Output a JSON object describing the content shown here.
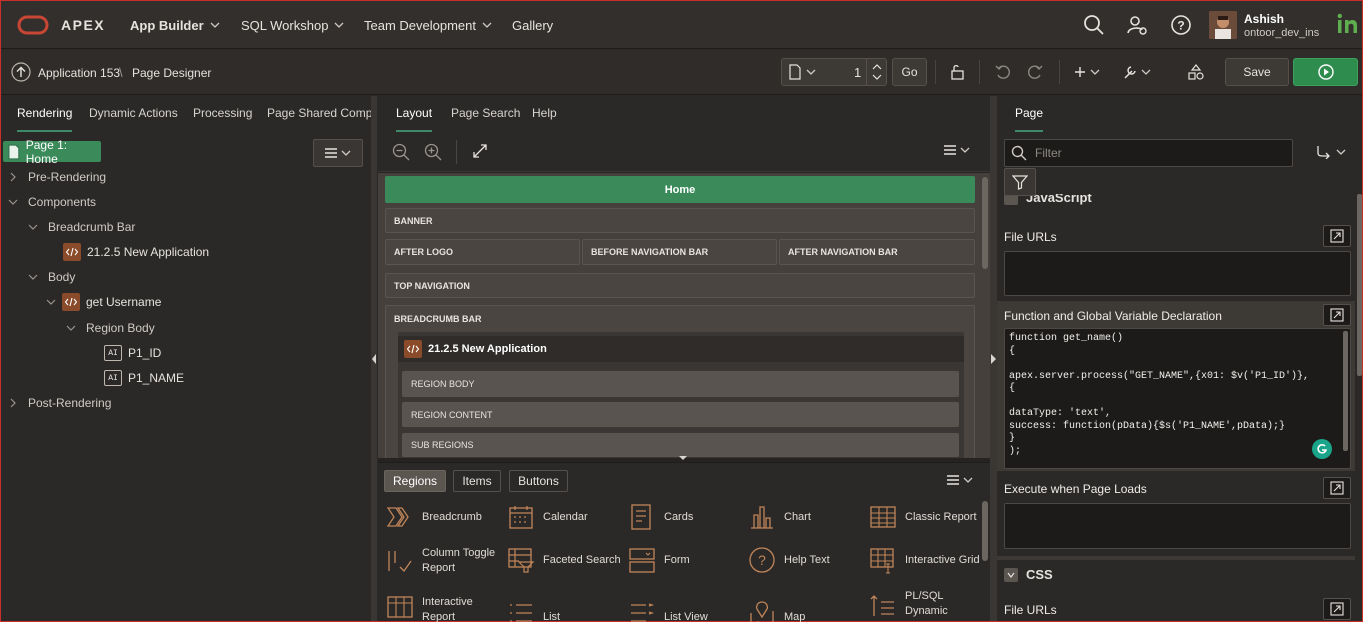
{
  "topbar": {
    "brand": "APEX",
    "nav": [
      "App Builder",
      "SQL Workshop",
      "Team Development",
      "Gallery"
    ],
    "user_name": "Ashish",
    "user_workspace": "ontoor_dev_ins",
    "colors": {
      "bg": "#332f2c",
      "brand_red": "#c74634"
    }
  },
  "toolbar": {
    "breadcrumb_app": "Application 153",
    "breadcrumb_sep": "\\",
    "breadcrumb_page": "Page Designer",
    "page_number": "1",
    "go_label": "Go",
    "save_label": "Save",
    "colors": {
      "run_button": "#2f8c4f"
    }
  },
  "left": {
    "tabs": [
      "Rendering",
      "Dynamic Actions",
      "Processing",
      "Page Shared Compor"
    ],
    "page_node": "Page 1: Home",
    "tree": {
      "pre_rendering": "Pre-Rendering",
      "components": "Components",
      "breadcrumb_bar": "Breadcrumb Bar",
      "breadcrumb_region": "21.2.5 New Application",
      "body": "Body",
      "get_username": "get Username",
      "region_body": "Region Body",
      "item1": "P1_ID",
      "item2": "P1_NAME",
      "post_rendering": "Post-Rendering",
      "item_icon": "AI"
    }
  },
  "center": {
    "tabs": [
      "Layout",
      "Page Search",
      "Help"
    ],
    "layout": {
      "page_title": "Home",
      "banner": "BANNER",
      "after_logo": "AFTER LOGO",
      "before_nav": "BEFORE NAVIGATION BAR",
      "after_nav": "AFTER NAVIGATION BAR",
      "top_nav": "TOP NAVIGATION",
      "breadcrumb_bar": "BREADCRUMB BAR",
      "region_title": "21.2.5 New Application",
      "region_body": "REGION BODY",
      "region_content": "REGION CONTENT",
      "sub_regions": "SUB REGIONS"
    },
    "gallery_tabs": [
      "Regions",
      "Items",
      "Buttons"
    ],
    "gallery": [
      "Breadcrumb",
      "Calendar",
      "Cards",
      "Chart",
      "Classic Report",
      "Column Toggle Report",
      "Faceted Search",
      "Form",
      "Help Text",
      "Interactive Grid",
      "Interactive Report",
      "List",
      "List View",
      "Map",
      "PL/SQL Dynamic"
    ]
  },
  "right": {
    "tab": "Page",
    "filter_placeholder": "Filter",
    "section_js_partial": "JavaScript",
    "file_urls_label": "File URLs",
    "function_label": "Function and Global Variable Declaration",
    "code_lines": [
      "function get_name()",
      "{",
      "",
      "apex.server.process(\"GET_NAME\",{x01: $v('P1_ID')},",
      "{",
      "",
      "dataType: 'text',",
      "success: function(pData){$s('P1_NAME',pData);}",
      "}",
      ");"
    ],
    "execute_label": "Execute when Page Loads",
    "css_label": "CSS",
    "css_file_urls_label": "File URLs"
  }
}
